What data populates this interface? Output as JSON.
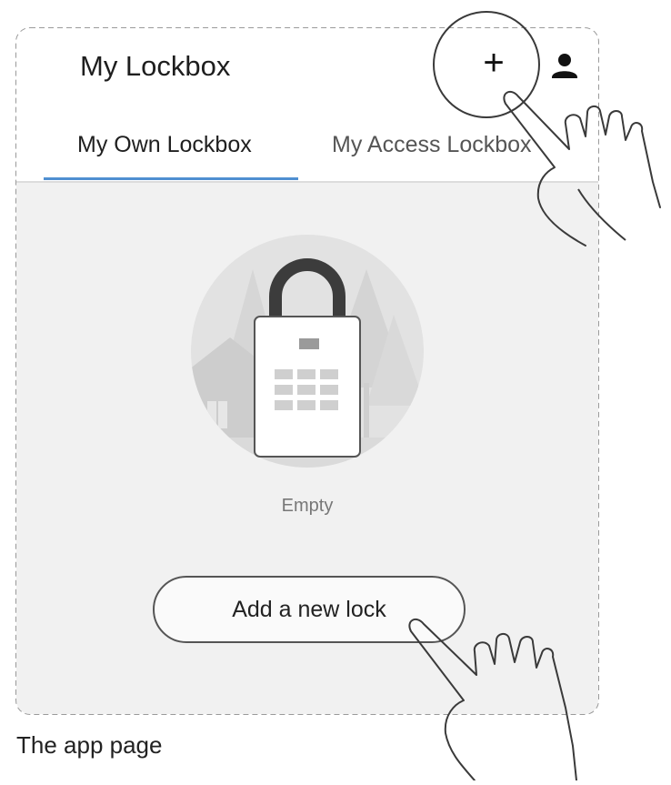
{
  "app": {
    "title": "My Lockbox"
  },
  "header": {
    "add_icon": "plus-icon",
    "add_glyph": "+",
    "user_icon": "user-icon"
  },
  "tabs": [
    {
      "label": "My Own Lockbox",
      "active": true
    },
    {
      "label": "My Access Lockbox",
      "active": false
    }
  ],
  "empty_state": {
    "illustration": "padlock-illustration",
    "text": "Empty"
  },
  "actions": {
    "add_lock_label": "Add a new lock"
  },
  "caption": "The app page",
  "colors": {
    "tab_underline": "#4f8fd1",
    "content_background": "#f1f1f1",
    "illustration_circle": "#e2e2e2"
  }
}
